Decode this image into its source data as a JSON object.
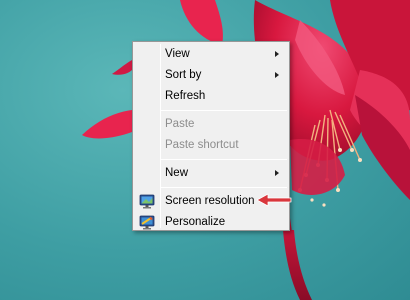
{
  "menu": {
    "items": [
      {
        "label": "View",
        "submenu": true,
        "enabled": true
      },
      {
        "label": "Sort by",
        "submenu": true,
        "enabled": true
      },
      {
        "label": "Refresh",
        "submenu": false,
        "enabled": true
      },
      {
        "label": "Paste",
        "submenu": false,
        "enabled": false
      },
      {
        "label": "Paste shortcut",
        "submenu": false,
        "enabled": false
      },
      {
        "label": "New",
        "submenu": true,
        "enabled": true
      },
      {
        "label": "Screen resolution",
        "submenu": false,
        "enabled": true,
        "icon": "monitor-icon"
      },
      {
        "label": "Personalize",
        "submenu": false,
        "enabled": true,
        "icon": "personalize-icon"
      }
    ]
  },
  "annotation": {
    "arrow_color": "#d9363c",
    "target": "Screen resolution"
  },
  "colors": {
    "desktop_background": "#4aa6a9",
    "flower": "#e8244e",
    "menu_background": "#f0f0f0",
    "disabled_text": "#8d8d8d"
  }
}
